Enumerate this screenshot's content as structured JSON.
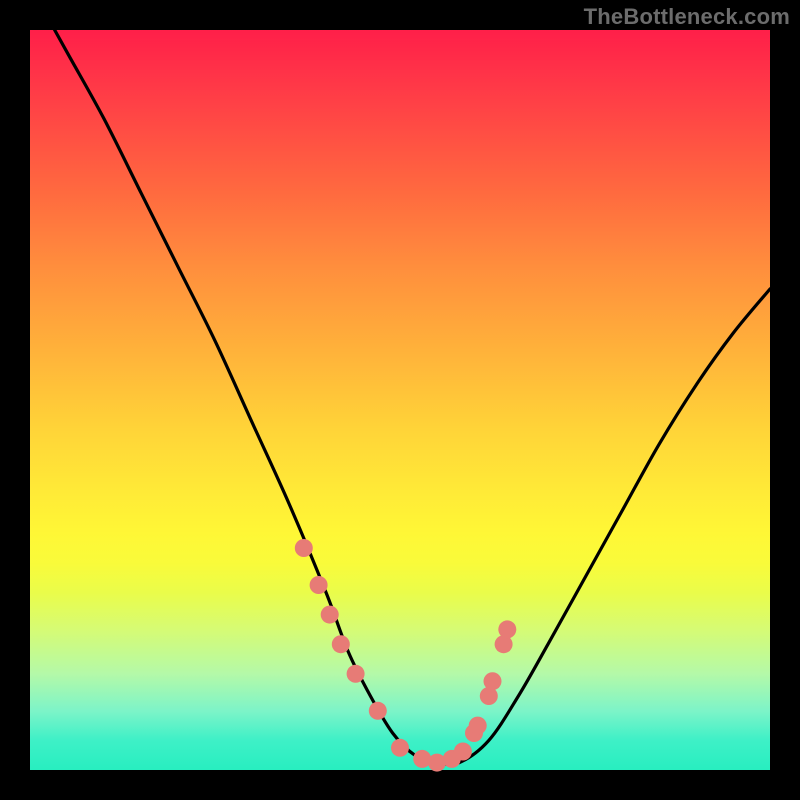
{
  "watermark": "TheBottleneck.com",
  "colors": {
    "frame": "#000000",
    "curve": "#000000",
    "marker_fill": "#e77b76",
    "marker_stroke": "#d46a66"
  },
  "chart_data": {
    "type": "line",
    "title": "",
    "xlabel": "",
    "ylabel": "",
    "xlim": [
      0,
      100
    ],
    "ylim": [
      0,
      100
    ],
    "grid": false,
    "legend": false,
    "series": [
      {
        "name": "bottleneck-curve",
        "x": [
          0,
          5,
          10,
          15,
          20,
          25,
          30,
          35,
          40,
          43,
          46,
          49,
          52,
          55,
          58,
          62,
          66,
          70,
          75,
          80,
          85,
          90,
          95,
          100
        ],
        "y": [
          106,
          97,
          88,
          78,
          68,
          58,
          47,
          36,
          24,
          16,
          10,
          5,
          2,
          1,
          1,
          4,
          10,
          17,
          26,
          35,
          44,
          52,
          59,
          65
        ]
      }
    ],
    "markers": {
      "name": "highlight-points",
      "x": [
        37,
        39,
        40.5,
        42,
        44,
        47,
        50,
        53,
        55,
        57,
        58.5,
        60,
        60.5,
        62,
        62.5,
        64,
        64.5
      ],
      "y": [
        30,
        25,
        21,
        17,
        13,
        8,
        3,
        1.5,
        1,
        1.5,
        2.5,
        5,
        6,
        10,
        12,
        17,
        19
      ]
    }
  }
}
